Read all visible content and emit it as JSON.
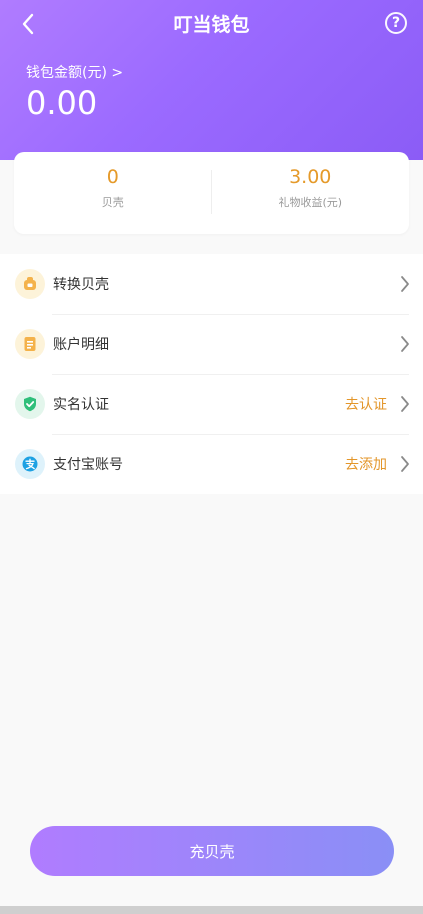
{
  "header": {
    "title": "叮当钱包",
    "back_icon": "chevron-left-icon",
    "help_icon": "question-circle-icon",
    "help_glyph": "?"
  },
  "wallet": {
    "label": "钱包金额(元) >",
    "amount": "0.00"
  },
  "stats": [
    {
      "value": "0",
      "label": "贝壳"
    },
    {
      "value": "3.00",
      "label": "礼物收益(元)"
    }
  ],
  "menu": [
    {
      "label": "转换贝壳",
      "icon": "exchange-icon",
      "action": ""
    },
    {
      "label": "账户明细",
      "icon": "document-icon",
      "action": ""
    },
    {
      "label": "实名认证",
      "icon": "shield-check-icon",
      "action": "去认证"
    },
    {
      "label": "支付宝账号",
      "icon": "alipay-icon",
      "action": "去添加"
    }
  ],
  "cta": {
    "label": "充贝壳"
  },
  "colors": {
    "accent": "#9b6aff",
    "orange": "#e3962a",
    "gradient_start": "#b07cff",
    "gradient_end": "#8a8ff6"
  }
}
